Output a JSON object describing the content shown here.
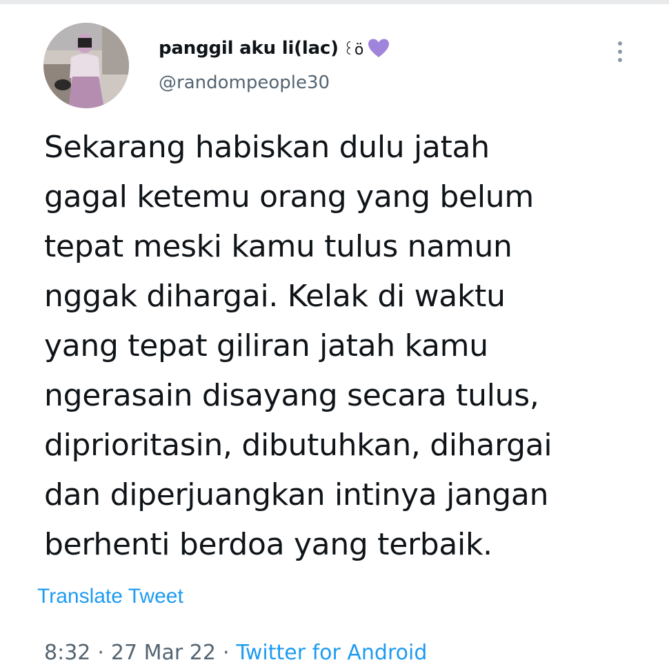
{
  "tweet": {
    "author": {
      "display_name": "panggil aku li(lac)",
      "display_name_emoji": "꒰ö",
      "handle": "@randompeople30",
      "avatar_icon": "profile-photo"
    },
    "text_lines": [
      "Sekarang habiskan dulu jatah",
      "gagal ketemu orang yang belum",
      "tepat meski kamu tulus namun",
      "nggak dihargai. Kelak di waktu",
      "yang tepat giliran jatah kamu",
      "ngerasain disayang secara tulus,",
      "diprioritasin, dibutuhkan, dihargai",
      "dan diperjuangkan intinya jangan",
      "berhenti berdoa yang terbaik."
    ],
    "translate_label": "Translate Tweet",
    "time": "8:32",
    "separator": "·",
    "date": "27 Mar 22",
    "source": "Twitter for Android",
    "heart_color": "#a084dc",
    "link_color": "#1d9bf0"
  }
}
